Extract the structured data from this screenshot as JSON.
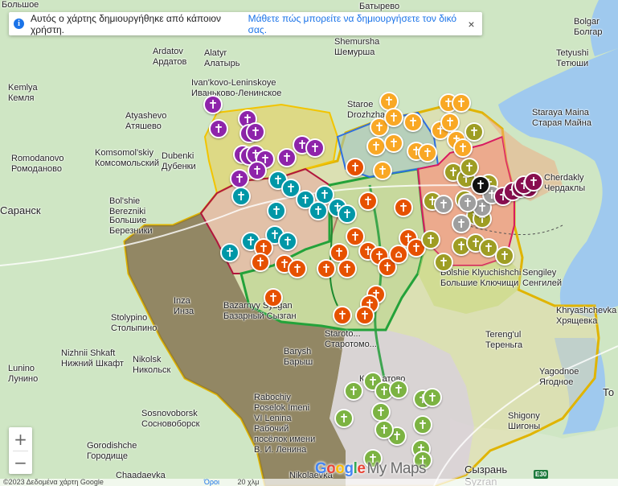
{
  "notice": {
    "message": "Αυτός ο χάρτης δημιουργήθηκε από κάποιον χρήστη.",
    "learn_more": "Μάθετε πώς μπορείτε να δημιουργήσετε τον δικό σας.",
    "close_icon": "×"
  },
  "zoom": {
    "in": "+",
    "out": "−"
  },
  "logo": {
    "google": "Google",
    "mymaps": "My Maps"
  },
  "footer": {
    "copyright": "©2023 Δεδομένα χάρτη Google",
    "terms": "Όροι",
    "scale": "20 χλμ"
  },
  "road_badge": "E30",
  "colors": {
    "purple": "#8e24aa",
    "teal": "#0097a7",
    "orange": "#e65100",
    "gold": "#f9a825",
    "olive": "#9e9d24",
    "lightgreen": "#7cb342",
    "silver": "#9e9e9e",
    "maroon": "#880e4f",
    "black": "#111111",
    "water": "#9fc9ee"
  },
  "places": [
    {
      "name": "Bolshoye",
      "alt": "Большое"
    },
    {
      "name": "Batyrevo",
      "alt": "Батырево"
    },
    {
      "name": "Shemursha",
      "alt": "Шемурша"
    },
    {
      "name": "Bolgar",
      "alt": "Болгар"
    },
    {
      "name": "Tetyushi",
      "alt": "Тетюши"
    },
    {
      "name": "Ardatov",
      "alt": "Ардатов"
    },
    {
      "name": "Alatyr",
      "alt": "Алатырь"
    },
    {
      "name": "Ivan'kovo-Leninskoye",
      "alt": "Иваньково-Ленинское"
    },
    {
      "name": "Kemlya",
      "alt": "Кемля"
    },
    {
      "name": "Atyashevo",
      "alt": "Атяшево"
    },
    {
      "name": "Komsomol'skiy",
      "alt": "Комсомольский"
    },
    {
      "name": "Romodanovo",
      "alt": "Ромоданово"
    },
    {
      "name": "Dubenki",
      "alt": "Дубенки"
    },
    {
      "name": "Staroe",
      "alt": "Drozhzhan..."
    },
    {
      "name": "Staraya Maina",
      "alt": "Старая Майна"
    },
    {
      "name": "Cherdakly",
      "alt": "Чердаклы"
    },
    {
      "name": "Bol'shie",
      "alt": "Berezniki"
    },
    {
      "name": "Большие",
      "alt": "Березники"
    },
    {
      "name": "Saransk",
      "alt": "Саранск"
    },
    {
      "name": "Bolshie Klyuchishchi",
      "alt": "Большие Ключищи"
    },
    {
      "name": "Sengiley",
      "alt": "Сенгилей"
    },
    {
      "name": "Inza",
      "alt": "Инза"
    },
    {
      "name": "Stolypino",
      "alt": "Столыпино"
    },
    {
      "name": "Bazarnyy Syzgan",
      "alt": "Базарный Сызган"
    },
    {
      "name": "Staroto...",
      "alt": "Старотомо..."
    },
    {
      "name": "Tereng'ul",
      "alt": "Тереньга"
    },
    {
      "name": "Khryashchevka",
      "alt": "Хрящевка"
    },
    {
      "name": "Nizhnii Shkaft",
      "alt": "Нижний Шкафт"
    },
    {
      "name": "Nikolsk",
      "alt": "Никольск"
    },
    {
      "name": "Barysh",
      "alt": "Барыш"
    },
    {
      "name": "Lunino",
      "alt": "Лунино"
    },
    {
      "name": "Yagodnoe",
      "alt": "Ягодное"
    },
    {
      "name": "Rabochiy Poselok Imeni VI Lenina",
      "alt": "Рабочий посёлок имени В. И. Ленина"
    },
    {
      "name": "Kuzovatovo",
      "alt": "Кузоватово"
    },
    {
      "name": "Shigony",
      "alt": "Шигоны"
    },
    {
      "name": "Sosnovoborsk",
      "alt": "Сосновоборск"
    },
    {
      "name": "Gorodishche",
      "alt": "Городище"
    },
    {
      "name": "Chaadaevka",
      "alt": "Чаадаевка"
    },
    {
      "name": "Nikolaevka",
      "alt": "Николаевка"
    },
    {
      "name": "Сызрань",
      "alt": "Syzran"
    },
    {
      "name": "Tolyatti",
      "alt": "То"
    }
  ]
}
